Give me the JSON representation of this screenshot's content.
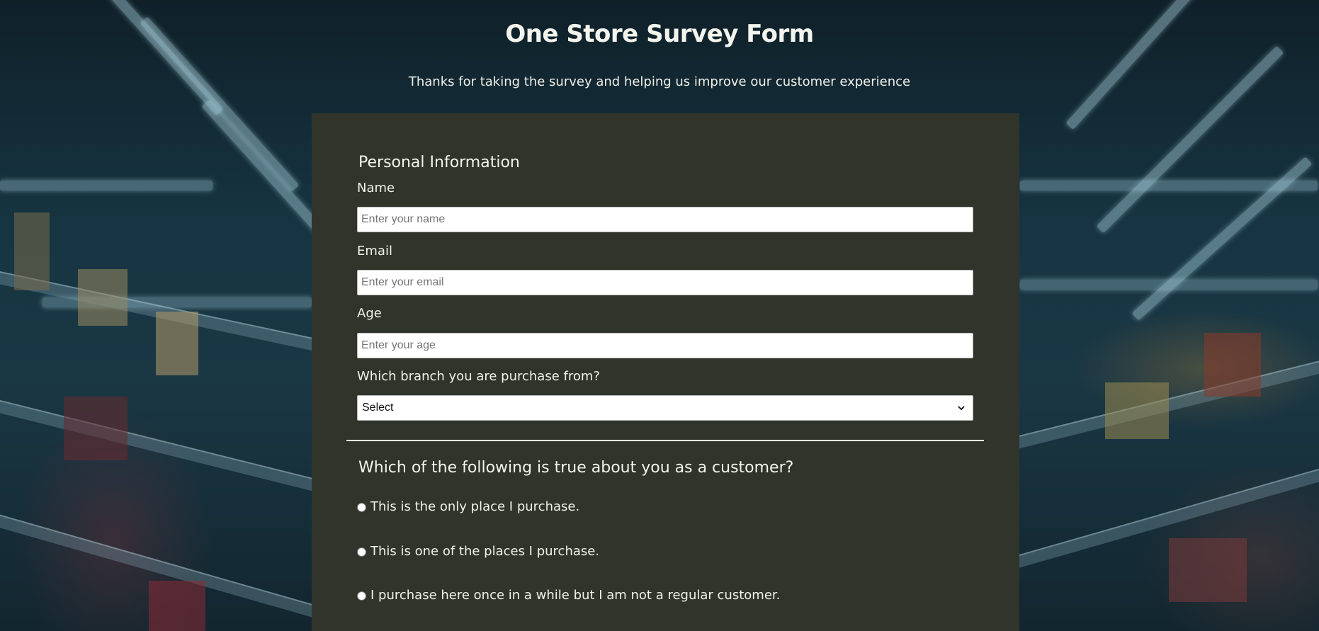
{
  "header": {
    "title": "One Store Survey Form",
    "subtitle": "Thanks for taking the survey and helping us improve our customer experience"
  },
  "personal": {
    "section_title": "Personal Information",
    "name_label": "Name",
    "name_placeholder": "Enter your name",
    "email_label": "Email",
    "email_placeholder": "Enter your email",
    "age_label": "Age",
    "age_placeholder": "Enter your age",
    "branch_label": "Which branch you are purchase from?",
    "branch_selected": "Select"
  },
  "customer": {
    "question": "Which of the following is true about you as a customer?",
    "options": [
      "This is the only place I purchase.",
      "This is one of the places I purchase.",
      "I purchase here once in a while but I am not a regular customer."
    ]
  },
  "colors": {
    "form_background": "#30342b",
    "page_text": "#f2f2ec"
  }
}
